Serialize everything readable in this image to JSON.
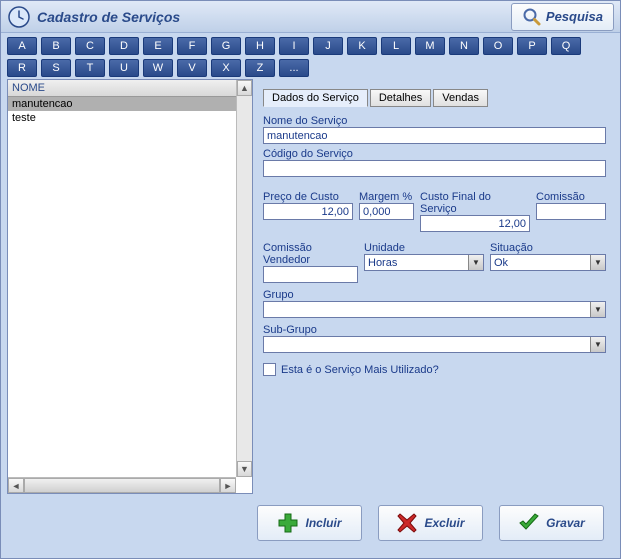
{
  "title": "Cadastro de Serviços",
  "search_label": "Pesquisa",
  "alpha": [
    "A",
    "B",
    "C",
    "D",
    "E",
    "F",
    "G",
    "H",
    "I",
    "J",
    "K",
    "L",
    "M",
    "N",
    "O",
    "P",
    "Q",
    "R",
    "S",
    "T",
    "U",
    "W",
    "V",
    "X",
    "Z",
    "..."
  ],
  "list": {
    "header": "NOME",
    "rows": [
      "manutencao",
      "teste"
    ],
    "selected_index": 0
  },
  "tabs": {
    "items": [
      "Dados do Serviço",
      "Detalhes",
      "Vendas"
    ],
    "active_index": 0
  },
  "form": {
    "nome_label": "Nome do Serviço",
    "nome_value": "manutencao",
    "codigo_label": "Código do Serviço",
    "codigo_value": "",
    "preco_label": "Preço de Custo",
    "preco_value": "12,00",
    "margem_label": "Margem %",
    "margem_value": "0,000",
    "custo_final_label": "Custo Final do Serviço",
    "custo_final_value": "12,00",
    "comissao_label": "Comissão",
    "comissao_value": "",
    "comissao_vend_label": "Comissão Vendedor",
    "comissao_vend_value": "",
    "unidade_label": "Unidade",
    "unidade_value": "Horas",
    "situacao_label": "Situação",
    "situacao_value": "Ok",
    "grupo_label": "Grupo",
    "grupo_value": "",
    "subgrupo_label": "Sub-Grupo",
    "subgrupo_value": "",
    "mais_utilizado_label": "Esta é o Serviço Mais Utilizado?"
  },
  "actions": {
    "incluir": "Incluir",
    "excluir": "Excluir",
    "gravar": "Gravar"
  }
}
